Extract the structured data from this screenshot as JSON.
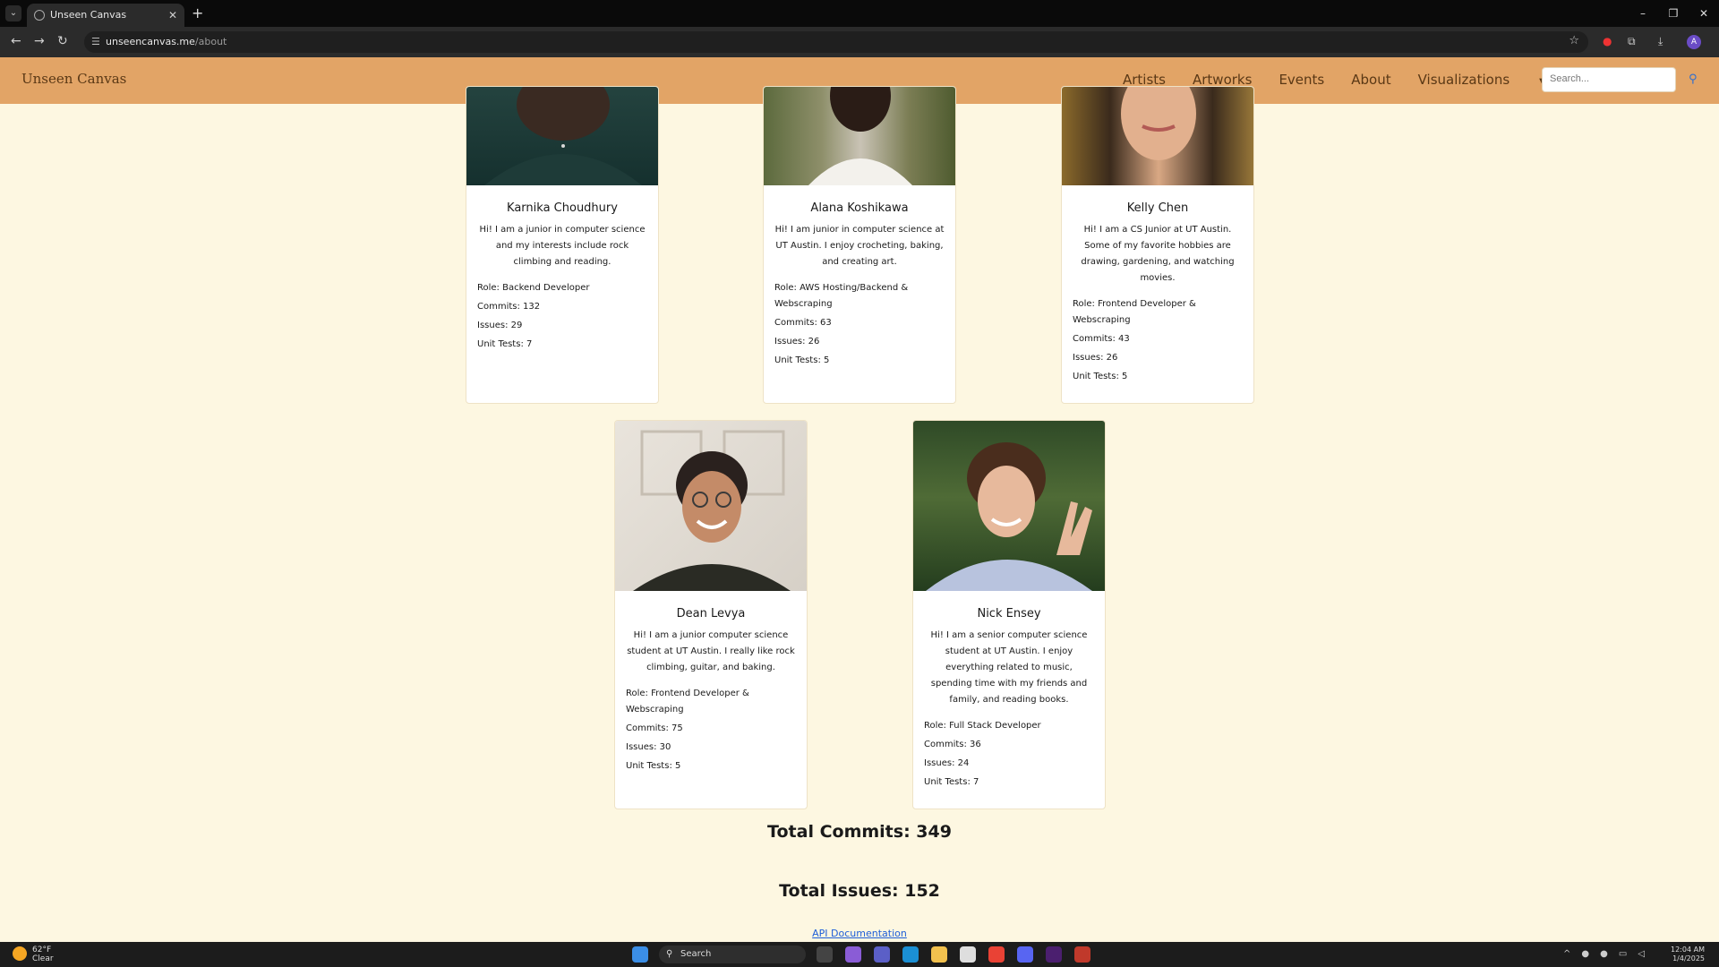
{
  "browser": {
    "tab_title": "Unseen Canvas",
    "new_tab": "+",
    "url_domain": "unseencanvas.me",
    "url_path": "/about",
    "window_controls": [
      "–",
      "❐",
      "✕"
    ]
  },
  "nav": {
    "brand": "Unseen Canvas",
    "links": [
      "Artists",
      "Artworks",
      "Events",
      "About",
      "Visualizations"
    ],
    "search_placeholder": "Search..."
  },
  "team": [
    {
      "name": "Karnika Choudhury",
      "bio": "Hi! I am a junior in computer science and my interests include rock climbing and reading.",
      "role": "Role: Backend Developer",
      "commits": "Commits: 132",
      "issues": "Issues: 29",
      "unit_tests": "Unit Tests: 7"
    },
    {
      "name": "Alana Koshikawa",
      "bio": "Hi! I am junior in computer science at UT Austin. I enjoy crocheting, baking, and creating art.",
      "role": "Role: AWS Hosting/Backend & Webscraping",
      "commits": "Commits: 63",
      "issues": "Issues: 26",
      "unit_tests": "Unit Tests: 5"
    },
    {
      "name": "Kelly Chen",
      "bio": "Hi! I am a CS Junior at UT Austin. Some of my favorite hobbies are drawing, gardening, and watching movies.",
      "role": "Role: Frontend Developer & Webscraping",
      "commits": "Commits: 43",
      "issues": "Issues: 26",
      "unit_tests": "Unit Tests: 5"
    },
    {
      "name": "Dean Levya",
      "bio": "Hi! I am a junior computer science student at UT Austin. I really like rock climbing, guitar, and baking.",
      "role": "Role: Frontend Developer & Webscraping",
      "commits": "Commits: 75",
      "issues": "Issues: 30",
      "unit_tests": "Unit Tests: 5"
    },
    {
      "name": "Nick Ensey",
      "bio": "Hi! I am a senior computer science student at UT Austin. I enjoy everything related to music, spending time with my friends and family, and reading books.",
      "role": "Role: Full Stack Developer",
      "commits": "Commits: 36",
      "issues": "Issues: 24",
      "unit_tests": "Unit Tests: 7"
    }
  ],
  "totals": {
    "commits": "Total Commits: 349",
    "issues": "Total Issues: 152"
  },
  "api_link": "API Documentation",
  "taskbar": {
    "weather_temp": "62°F",
    "weather_desc": "Clear",
    "search": "Search",
    "time": "12:04 AM",
    "date": "1/4/2025"
  },
  "colors": {
    "page_bg": "#fdf7e1",
    "navbar_bg": "#e2a466",
    "nav_text": "#5a3815",
    "link": "#1d5ed8"
  }
}
